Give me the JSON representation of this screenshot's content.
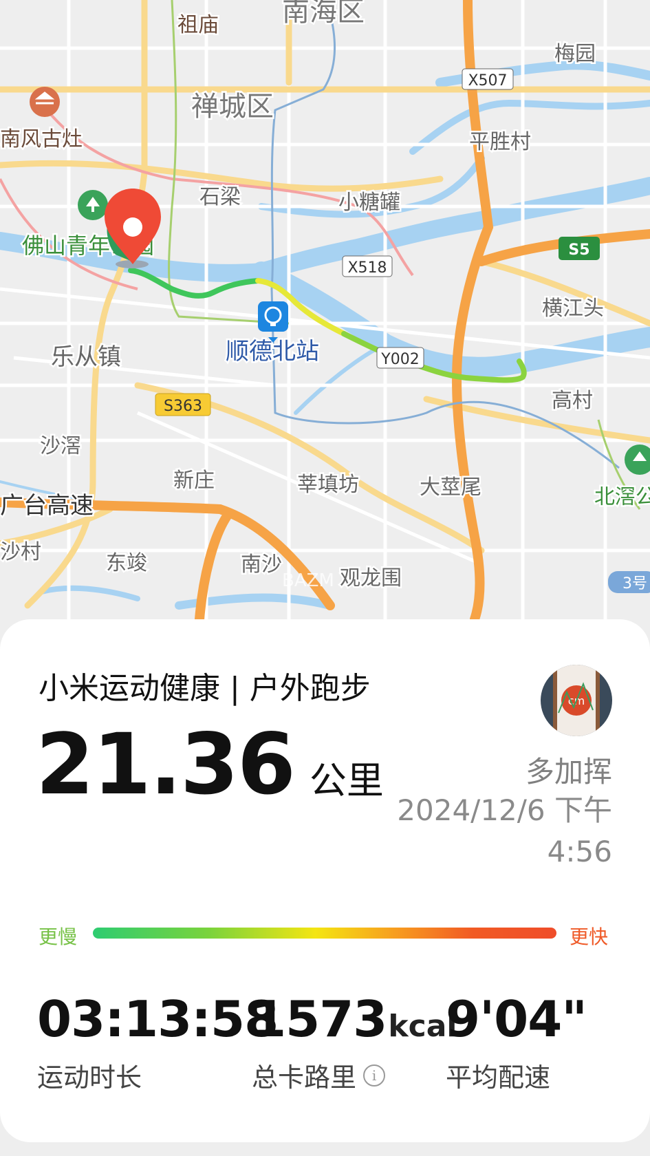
{
  "map": {
    "districts": [
      "南海区",
      "禅城区"
    ],
    "places": [
      "祖庙",
      "梅园",
      "南风古灶",
      "平胜村",
      "石梁",
      "小糖罐",
      "佛山青年公园",
      "横江头",
      "顺德北站",
      "乐从镇",
      "高村",
      "沙滘",
      "新庄",
      "莘填坊",
      "大莖尾",
      "北滘公",
      "广台高速",
      "沙村",
      "东竣",
      "南沙",
      "观龙围"
    ],
    "road_badges": [
      "X507",
      "X518",
      "Y002",
      "S363",
      "S5",
      "3号"
    ],
    "watermark": "BAZM",
    "route_colors": {
      "slow": "#2ecc71",
      "medium": "#7ad33c",
      "fast": "#f4e512"
    }
  },
  "card": {
    "title": "小米运动健康 | 户外跑步",
    "distance_value": "21.36",
    "distance_unit": "公里",
    "user_name": "多加挥",
    "datetime": "2024/12/6 下午 4:56",
    "legend_slow": "更慢",
    "legend_fast": "更快",
    "stats": [
      {
        "value": "03:13:58",
        "unit": "",
        "label": "运动时长"
      },
      {
        "value": "1573",
        "unit": "kcal",
        "label": "总卡路里"
      },
      {
        "value": "9'04\"",
        "unit": "",
        "label": "平均配速"
      }
    ]
  }
}
